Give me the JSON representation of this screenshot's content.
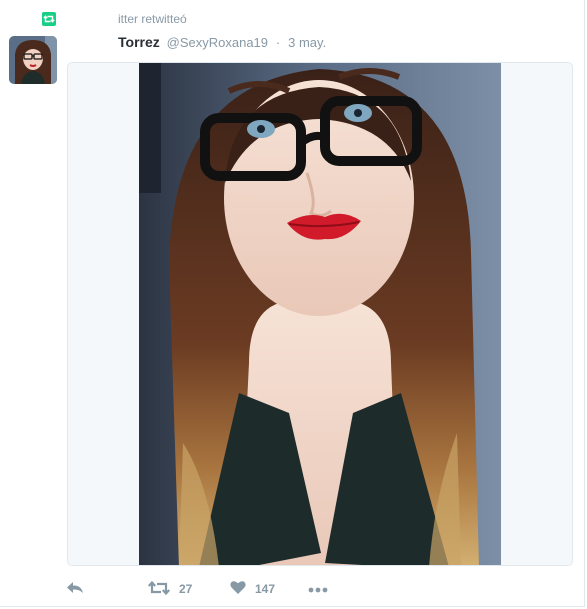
{
  "retweet_context": {
    "text": "itter retwitteó",
    "icon": "retweet-icon",
    "accent": "#19cf86"
  },
  "tweet": {
    "fullname": "Torrez",
    "username": "@SexyRoxana19",
    "separator": "·",
    "timestamp": "3 may.",
    "media_alt": "Selfie photo"
  },
  "actions": {
    "reply_icon": "reply-icon",
    "retweet_icon": "retweet-icon",
    "retweet_count": "27",
    "like_icon": "heart-icon",
    "like_count": "147",
    "more_icon": "more-icon"
  },
  "colors": {
    "muted": "#8899a6",
    "text": "#292f33",
    "border": "#e1e8ed"
  }
}
